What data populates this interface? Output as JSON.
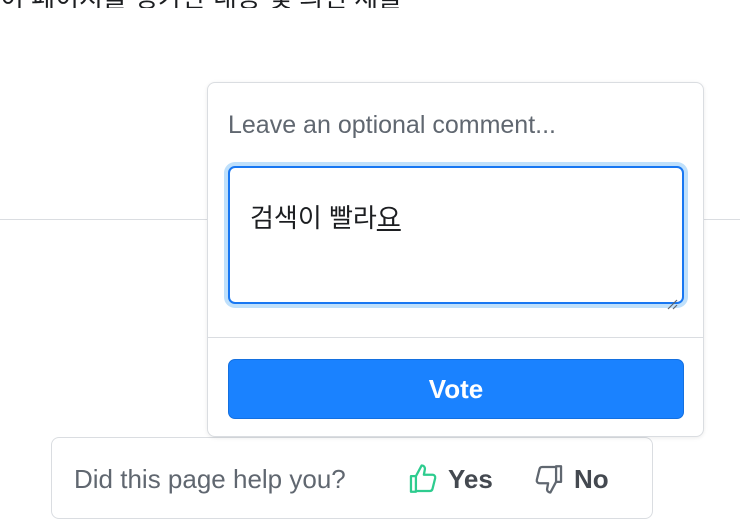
{
  "top_text": "이 페이지를 평가한 내용 및 의견 제출",
  "popover": {
    "comment_placeholder": "Leave an optional comment...",
    "comment_value": "검색이 빨라",
    "comment_value_composing": "요",
    "vote_label": "Vote"
  },
  "feedback": {
    "question": "Did this page help you?",
    "yes_label": "Yes",
    "no_label": "No"
  },
  "colors": {
    "accent": "#1a82ff",
    "focus_ring": "#bfe0fb",
    "yes_icon": "#2ecc8f",
    "muted_text": "#606770"
  },
  "icons": {
    "yes": "thumbs-up-icon",
    "no": "thumbs-down-icon",
    "resize": "resize-handle-icon"
  }
}
